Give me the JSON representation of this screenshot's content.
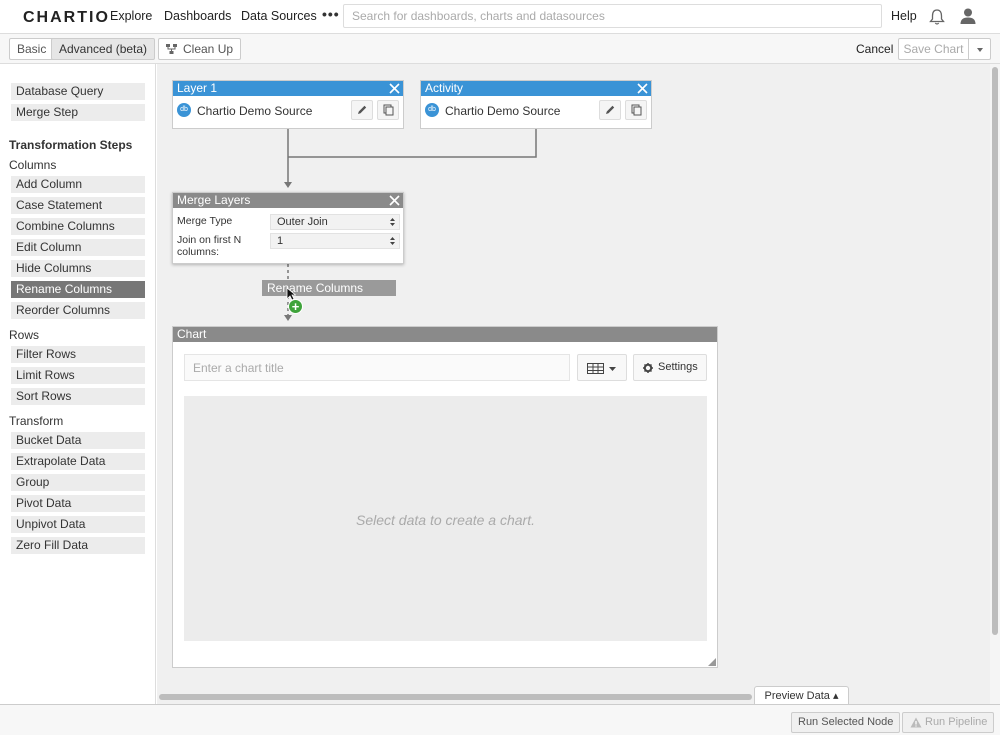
{
  "nav": {
    "logo": "CHARTIO",
    "links": [
      "Explore",
      "Dashboards",
      "Data Sources"
    ],
    "more": "•••",
    "search_placeholder": "Search for dashboards, charts and datasources",
    "help": "Help",
    "bell_icon": "bell-icon",
    "user_icon": "user-icon"
  },
  "toolbar": {
    "tab_basic": "Basic",
    "tab_advanced": "Advanced (beta)",
    "cleanup": "Clean Up",
    "cancel": "Cancel",
    "save_chart": "Save Chart"
  },
  "sidebar": {
    "sources": [
      "Database Query",
      "Merge Step"
    ],
    "transformation_heading": "Transformation Steps",
    "columns_label": "Columns",
    "columns_items": [
      "Add Column",
      "Case Statement",
      "Combine Columns",
      "Edit Column",
      "Hide Columns",
      "Rename Columns",
      "Reorder Columns"
    ],
    "rows_label": "Rows",
    "rows_items": [
      "Filter Rows",
      "Limit Rows",
      "Sort Rows"
    ],
    "transform_label": "Transform",
    "transform_items": [
      "Bucket Data",
      "Extrapolate Data",
      "Group",
      "Pivot Data",
      "Unpivot Data",
      "Zero Fill Data"
    ]
  },
  "canvas": {
    "layer1": {
      "title": "Layer 1",
      "source": "Chartio Demo Source",
      "color": "#3a93d6"
    },
    "activity": {
      "title": "Activity",
      "source": "Chartio Demo Source"
    },
    "merge": {
      "title": "Merge Layers",
      "type_label": "Merge Type",
      "type_value": "Outer Join",
      "join_label": "Join on first N columns:",
      "join_value": "1"
    },
    "rename_step": "Rename Columns",
    "chart": {
      "header": "Chart",
      "title_placeholder": "Enter a chart title",
      "settings": "Settings",
      "empty": "Select data to create a chart."
    }
  },
  "preview": "Preview Data ▴",
  "footer": {
    "run_selected": "Run Selected Node",
    "run_pipeline": "Run Pipeline"
  },
  "colors": {
    "layer_blue": "#3a93d6",
    "add_green": "#3fa33b"
  }
}
